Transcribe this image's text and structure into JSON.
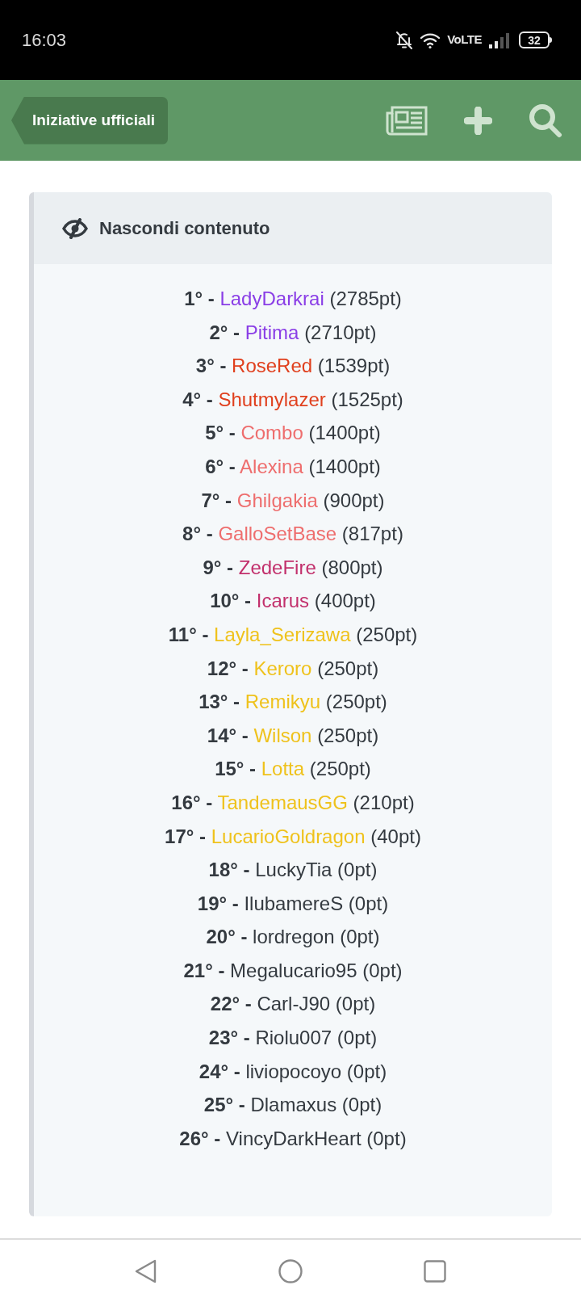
{
  "status_bar": {
    "time": "16:03",
    "network": "VoLTE",
    "battery": "32"
  },
  "header": {
    "breadcrumb": "Iniziative ufficiali"
  },
  "spoiler": {
    "toggle_label": "Nascondi contenuto",
    "rows": [
      {
        "rank": "1° -",
        "name": "LadyDarkrai",
        "points": "(2785pt)",
        "color": "#8a3ee6"
      },
      {
        "rank": "2° -",
        "name": "Pitima",
        "points": "(2710pt)",
        "color": "#8a3ee6"
      },
      {
        "rank": "3° -",
        "name": "RoseRed",
        "points": "(1539pt)",
        "color": "#e0401e"
      },
      {
        "rank": "4° -",
        "name": "Shutmylazer",
        "points": "(1525pt)",
        "color": "#e0401e"
      },
      {
        "rank": "5° -",
        "name": "Combo",
        "points": "(1400pt)",
        "color": "#ee6e6e"
      },
      {
        "rank": "6° -",
        "name": "Alexina",
        "points": "(1400pt)",
        "color": "#ee6e6e"
      },
      {
        "rank": "7° -",
        "name": "Ghilgakia",
        "points": "(900pt)",
        "color": "#ee6e6e"
      },
      {
        "rank": "8° -",
        "name": "GalloSetBase",
        "points": "(817pt)",
        "color": "#ee6e6e"
      },
      {
        "rank": "9° -",
        "name": "ZedeFire",
        "points": "(800pt)",
        "color": "#c2306c"
      },
      {
        "rank": "10° -",
        "name": "Icarus",
        "points": "(400pt)",
        "color": "#c2306c"
      },
      {
        "rank": "11° -",
        "name": "Layla_Serizawa",
        "points": "(250pt)",
        "color": "#efc21c"
      },
      {
        "rank": "12° -",
        "name": "Keroro",
        "points": "(250pt)",
        "color": "#efc21c"
      },
      {
        "rank": "13° -",
        "name": "Remikyu",
        "points": "(250pt)",
        "color": "#efc21c"
      },
      {
        "rank": "14° -",
        "name": "Wilson",
        "points": "(250pt)",
        "color": "#efc21c"
      },
      {
        "rank": "15° -",
        "name": "Lotta",
        "points": "(250pt)",
        "color": "#efc21c"
      },
      {
        "rank": "16° -",
        "name": "TandemausGG",
        "points": "(210pt)",
        "color": "#efc21c"
      },
      {
        "rank": "17° -",
        "name": "LucarioGoldragon",
        "points": "(40pt)",
        "color": "#efc21c"
      },
      {
        "rank": "18° -",
        "name": "LuckyTia",
        "points": "(0pt)",
        "color": "#343a40"
      },
      {
        "rank": "19° -",
        "name": "IlubamereS",
        "points": "(0pt)",
        "color": "#343a40"
      },
      {
        "rank": "20° -",
        "name": "lordregon",
        "points": "(0pt)",
        "color": "#343a40"
      },
      {
        "rank": "21° -",
        "name": "Megalucario95",
        "points": "(0pt)",
        "color": "#343a40"
      },
      {
        "rank": "22° -",
        "name": "Carl-J90",
        "points": "(0pt)",
        "color": "#343a40"
      },
      {
        "rank": "23° -",
        "name": "Riolu007",
        "points": "(0pt)",
        "color": "#343a40"
      },
      {
        "rank": "24° -",
        "name": "liviopocoyo",
        "points": "(0pt)",
        "color": "#343a40"
      },
      {
        "rank": "25° -",
        "name": "Dlamaxus",
        "points": "(0pt)",
        "color": "#343a40"
      },
      {
        "rank": "26° -",
        "name": "VincyDarkHeart",
        "points": "(0pt)",
        "color": "#343a40"
      }
    ]
  }
}
